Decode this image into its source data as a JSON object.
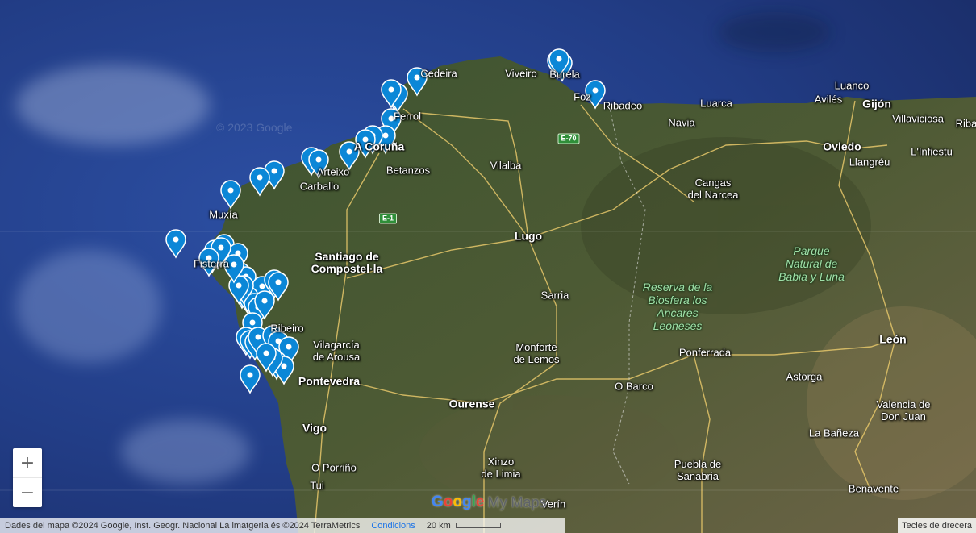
{
  "map": {
    "places": [
      {
        "name": "Viveiro",
        "type": "town"
      },
      {
        "name": "Burela",
        "type": "town"
      },
      {
        "name": "Ribadeo",
        "type": "town"
      },
      {
        "name": "Foz",
        "type": "town"
      },
      {
        "name": "Luarca",
        "type": "town"
      },
      {
        "name": "Luanco",
        "type": "town"
      },
      {
        "name": "Avilés",
        "type": "town"
      },
      {
        "name": "Gijón",
        "type": "city"
      },
      {
        "name": "Villaviciosa",
        "type": "town"
      },
      {
        "name": "Riba",
        "type": "town"
      },
      {
        "name": "Navia",
        "type": "town"
      },
      {
        "name": "Oviedo",
        "type": "city"
      },
      {
        "name": "L'Infiestu",
        "type": "town"
      },
      {
        "name": "Llangréu",
        "type": "town"
      },
      {
        "name": "Cangas\ndel Narcea",
        "type": "town"
      },
      {
        "name": "Ferrol",
        "type": "town"
      },
      {
        "name": "Cedeira",
        "type": "town"
      },
      {
        "name": "A Coruña",
        "type": "city"
      },
      {
        "name": "Arteixo",
        "type": "town"
      },
      {
        "name": "Betanzos",
        "type": "town"
      },
      {
        "name": "Vilalba",
        "type": "town"
      },
      {
        "name": "Carballo",
        "type": "town"
      },
      {
        "name": "Muxía",
        "type": "town"
      },
      {
        "name": "Fisterra",
        "type": "town"
      },
      {
        "name": "Santiago de\nCompostel·la",
        "type": "city"
      },
      {
        "name": "Lugo",
        "type": "city"
      },
      {
        "name": "Sarria",
        "type": "town"
      },
      {
        "name": "Vilagarcía\nde Arousa",
        "type": "town"
      },
      {
        "name": "Pontevedra",
        "type": "city"
      },
      {
        "name": "Monforte\nde Lemos",
        "type": "town"
      },
      {
        "name": "Ourense",
        "type": "city"
      },
      {
        "name": "Vigo",
        "type": "city"
      },
      {
        "name": "O Porriño",
        "type": "town"
      },
      {
        "name": "Tui",
        "type": "town"
      },
      {
        "name": "Xinzo\nde Limia",
        "type": "town"
      },
      {
        "name": "Verín",
        "type": "town"
      },
      {
        "name": "Ponferrada",
        "type": "town"
      },
      {
        "name": "O Barco",
        "type": "town"
      },
      {
        "name": "Astorga",
        "type": "town"
      },
      {
        "name": "León",
        "type": "city"
      },
      {
        "name": "La Bañeza",
        "type": "town"
      },
      {
        "name": "Valencia de\nDon Juan",
        "type": "town"
      },
      {
        "name": "Puebla de\nSanabria",
        "type": "town"
      },
      {
        "name": "Benavente",
        "type": "town"
      },
      {
        "name": "Ribeiro",
        "type": "town"
      },
      {
        "name": "Reserva de la\nBiosfera los\nAncares\nLeoneses",
        "type": "park"
      },
      {
        "name": "Parque\nNatural de\nBabia y Luna",
        "type": "park"
      }
    ],
    "roads": [
      {
        "name": "E-70"
      },
      {
        "name": "E-1"
      }
    ],
    "marker_color": "#0b87d7",
    "marker_count": 52,
    "watermark": "© 2023 Google"
  },
  "controls": {
    "zoom_in": "+",
    "zoom_out": "−"
  },
  "footer": {
    "attribution": "Dades del mapa ©2024 Google, Inst. Geogr. Nacional La imatgeria és ©2024 TerraMetrics",
    "conditions": "Condicions",
    "scale": "20 km",
    "shortcuts": "Tecles de drecera",
    "brand_google": "Google",
    "brand_mymaps": "My Maps"
  }
}
